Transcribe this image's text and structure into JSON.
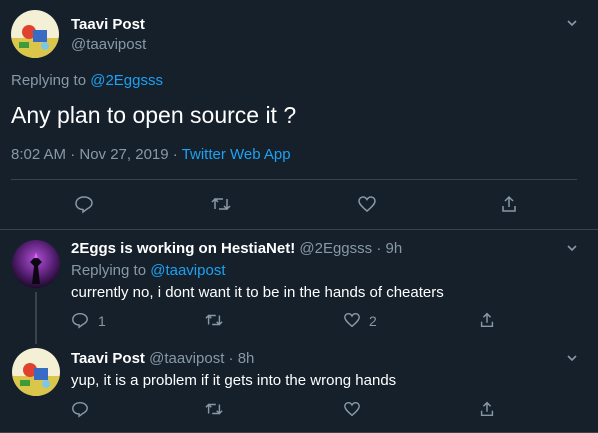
{
  "main_tweet": {
    "name": "Taavi Post",
    "handle": "@taavipost",
    "replying_prefix": "Replying to",
    "replying_to": "@2Eggsss",
    "text": "Any plan to open source it ?",
    "timestamp": "8:02 AM · Nov 27, 2019 ·",
    "source": "Twitter Web App"
  },
  "replies": [
    {
      "name": "2Eggs is working on HestiaNet!",
      "handle": "@2Eggsss",
      "time": "· 9h",
      "replying_prefix": "Replying to",
      "replying_to": "@taavipost",
      "text": "currently no, i dont want it to be in the hands of cheaters",
      "reply_count": "1",
      "like_count": "2"
    },
    {
      "name": "Taavi Post",
      "handle": "@taavipost",
      "time": "· 8h",
      "text": "yup, it is a problem if it gets into the wrong hands"
    }
  ],
  "icons": [
    "chevron-down-icon",
    "reply-icon",
    "retweet-icon",
    "like-icon",
    "share-icon"
  ],
  "colors": {
    "background": "#15202b",
    "accent": "#1da1f2",
    "muted": "#8899a6",
    "border": "#38444d"
  }
}
